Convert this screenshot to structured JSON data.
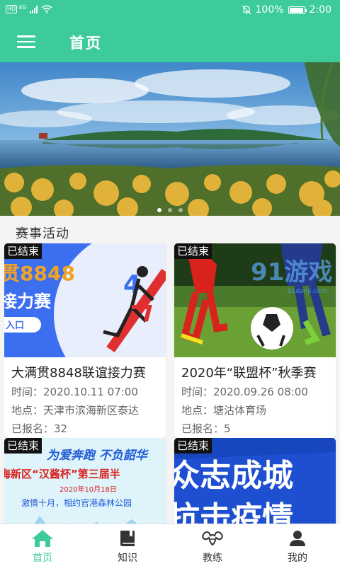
{
  "status_bar": {
    "network": "4G",
    "battery": "100%",
    "time": "2:00"
  },
  "header": {
    "title": "首页"
  },
  "banner": {
    "slide_count": 3,
    "active_index": 0
  },
  "section": {
    "title": "赛事活动"
  },
  "cards": [
    {
      "status": "已结束",
      "title": "大满贯8848联谊接力赛",
      "time": "时间：2020.10.11 07:00",
      "location": "地点：天津市滨海新区泰达",
      "signups": "已报名：32",
      "poster_text_top": "贯8848",
      "poster_text_bottom": "接力赛",
      "poster_badge": "入口"
    },
    {
      "status": "已结束",
      "title": "2020年“联盟杯”秋季赛",
      "time": "时间：2020.09.26 08:00",
      "location": "地点：塘沽体育场",
      "signups": "已报名：5",
      "watermark_big": "91游戏",
      "watermark_small": "91danji.com"
    },
    {
      "status": "已结束",
      "poster_line1": "为爱奔跑 不负韶华",
      "poster_line2": "海新区“汉酱杯”第三届半",
      "poster_date": "2020年10月18日",
      "poster_line3": "激情十月，相约官港森林公园"
    },
    {
      "status": "已结束",
      "poster_line1": "众志成城",
      "poster_line2": "抗击疫情"
    }
  ],
  "bottom_nav": [
    {
      "label": "首页",
      "icon": "home-icon",
      "active": true
    },
    {
      "label": "知识",
      "icon": "book-icon",
      "active": false
    },
    {
      "label": "教练",
      "icon": "muscle-icon",
      "active": false
    },
    {
      "label": "我的",
      "icon": "person-icon",
      "active": false
    }
  ],
  "colors": {
    "accent": "#3dcc99",
    "status_tag": "#111111"
  }
}
